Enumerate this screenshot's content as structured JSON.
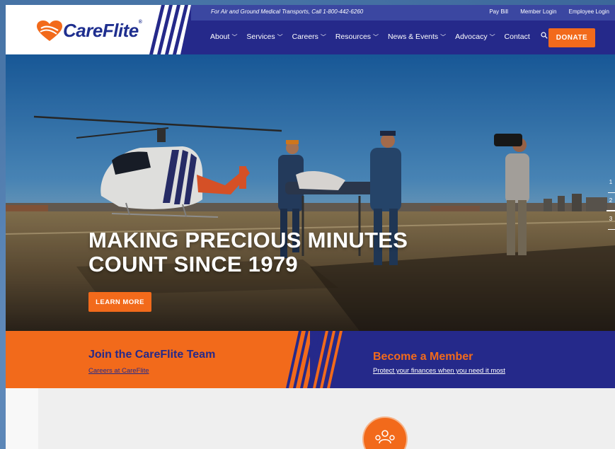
{
  "brand": {
    "name": "CareFlite",
    "reg": "®"
  },
  "topbar": {
    "call_text": "For Air and Ground Medical Transports, Call 1-800-442-6260",
    "links": [
      "Pay Bill",
      "Member Login",
      "Employee Login"
    ]
  },
  "nav": {
    "items": [
      {
        "label": "About"
      },
      {
        "label": "Services"
      },
      {
        "label": "Careers"
      },
      {
        "label": "Resources"
      },
      {
        "label": "News & Events"
      },
      {
        "label": "Advocacy"
      }
    ],
    "contact_label": "Contact",
    "search_icon": "search-icon",
    "donate_label": "DONATE"
  },
  "hero": {
    "title_line1": "MAKING PRECIOUS MINUTES",
    "title_line2": "COUNT SINCE 1979",
    "cta_label": "LEARN MORE",
    "slides": [
      "1",
      "2",
      "3"
    ],
    "active_slide": 2
  },
  "promo": {
    "left_title": "Join the CareFlite Team",
    "left_link": "Careers at CareFlite",
    "right_title": "Become a Member",
    "right_link": "Protect your finances when you need it most"
  },
  "colors": {
    "navy": "#25298a",
    "topbar": "#3b47a1",
    "orange": "#f26a1b",
    "white": "#ffffff"
  }
}
